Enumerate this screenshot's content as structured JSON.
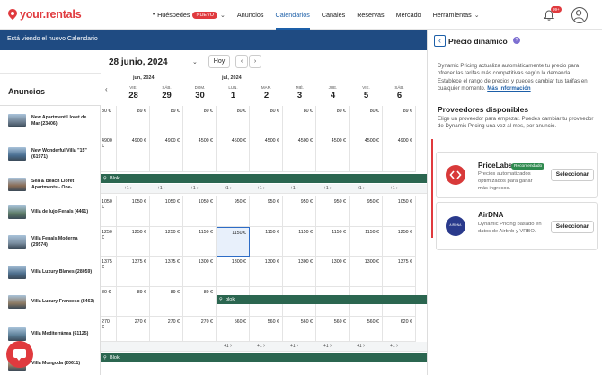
{
  "brand": {
    "name": "your.rentals",
    "accent": "#e03a3e"
  },
  "nav": {
    "items": [
      {
        "label": "Huéspedes",
        "badge": "NUEVO",
        "has_caret": true
      },
      {
        "label": "Anuncios"
      },
      {
        "label": "Calendarios",
        "active": true
      },
      {
        "label": "Canales"
      },
      {
        "label": "Reservas"
      },
      {
        "label": "Mercado"
      },
      {
        "label": "Herramientas",
        "has_caret": true
      }
    ],
    "notifications_count": "99+"
  },
  "banner": {
    "text": "Está viendo el nuevo Calendario"
  },
  "toolbar": {
    "date_title": "28 junio, 2024",
    "today_label": "Hoy",
    "prev": "‹",
    "next": "›"
  },
  "listings_header": "Anuncios",
  "calendar": {
    "months": [
      "jun, 2024",
      "jul, 2024"
    ],
    "days": [
      {
        "dow": "VIE.",
        "day": "28"
      },
      {
        "dow": "SÁB.",
        "day": "29"
      },
      {
        "dow": "DOM.",
        "day": "30"
      },
      {
        "dow": "LUN.",
        "day": "1"
      },
      {
        "dow": "MAR.",
        "day": "2"
      },
      {
        "dow": "MIÉ.",
        "day": "3"
      },
      {
        "dow": "JUE.",
        "day": "4"
      },
      {
        "dow": "VIE.",
        "day": "5"
      },
      {
        "dow": "SÁB.",
        "day": "6"
      }
    ],
    "rows": [
      {
        "name": "New Apartment Lloret de Mar (23406)",
        "lead": "80 €",
        "prices": [
          "89 €",
          "89 €",
          "80 €",
          "80 €",
          "80 €",
          "80 €",
          "80 €",
          "80 €",
          "89 €"
        ],
        "sub": null,
        "blk": null
      },
      {
        "name": "New Wonderful Villa \"15\" (61971)",
        "lead": "4900 €",
        "prices": [
          "4900 €",
          "4900 €",
          "4500 €",
          "4500 €",
          "4500 €",
          "4500 €",
          "4500 €",
          "4500 €",
          "4900 €"
        ],
        "sub": null,
        "blk": null
      },
      {
        "name": "Sea & Beach Lloret Apartments - One-...",
        "lead": "",
        "prices": [],
        "sub": [
          "+1",
          "+1",
          "+1",
          "+1",
          "+1",
          "+1",
          "+1",
          "+1",
          "+1"
        ],
        "blk": {
          "label": "Blok",
          "from": -1
        }
      },
      {
        "name": "Villa de lujo Fenals (4461)",
        "lead": "1050 €",
        "prices": [
          "1050 €",
          "1050 €",
          "1050 €",
          "950 €",
          "950 €",
          "950 €",
          "950 €",
          "950 €",
          "1050 €"
        ],
        "sub": null,
        "blk": null
      },
      {
        "name": "Villa Fenals Moderna (29574)",
        "lead": "1250 €",
        "prices": [
          "1250 €",
          "1250 €",
          "1150 €",
          "1150 €",
          "1150 €",
          "1150 €",
          "1150 €",
          "1150 €",
          "1250 €"
        ],
        "sub": null,
        "blk": null,
        "selected": 3
      },
      {
        "name": "Villa Luxury Blanes (28059)",
        "lead": "1375 €",
        "prices": [
          "1375 €",
          "1375 €",
          "1300 €",
          "1300 €",
          "1300 €",
          "1300 €",
          "1300 €",
          "1300 €",
          "1375 €"
        ],
        "sub": null,
        "blk": null
      },
      {
        "name": "Villa Luxury Francesc (8463)",
        "lead": "80 €",
        "prices": [
          "89 €",
          "89 €",
          "80 €",
          "",
          "",
          "",
          "",
          "",
          ""
        ],
        "sub": null,
        "blk": {
          "label": "blok",
          "from": 3
        }
      },
      {
        "name": "Villa Mediterránea (61125)",
        "lead": "270 €",
        "prices": [
          "270 €",
          "270 €",
          "270 €",
          "560 €",
          "560 €",
          "560 €",
          "560 €",
          "560 €",
          "620 €"
        ],
        "sub": [
          "",
          "",
          "",
          "+1",
          "+1",
          "+1",
          "+1",
          "+1",
          "+1"
        ],
        "blk": null
      },
      {
        "name": "Villa Mongoda (20611)",
        "lead": "",
        "prices": [],
        "sub": null,
        "blk": {
          "label": "Blok",
          "from": -1
        }
      }
    ]
  },
  "panel": {
    "title": "Precio dinamico",
    "description": "Dynamic Pricing actualiza automáticamente tu precio para ofrecer las tarifas más competitivas según la demanda. Establece el rango de precios y puedes cambiar tus tarifas en cualquier momento.",
    "more_link": "Más información",
    "providers_title": "Proveedores disponibles",
    "providers_desc": "Elige un proveedor para empezar. Puedes cambiar tu proveedor de Dynamic Pricing una vez al mes, por anuncio.",
    "providers": [
      {
        "name": "PriceLabs",
        "tag": "Recomendado",
        "desc": "Precios automatizados optimizados para ganar más ingresos.",
        "button": "Seleccionar",
        "logo_color": "#d83a3a",
        "logo_text": ""
      },
      {
        "name": "AirDNA",
        "tag": "",
        "desc": "Dynamic Pricing basado en datos de Airbnb y VRBO.",
        "button": "Seleccionar",
        "logo_color": "#2a3a8c",
        "logo_text": "AIRDNA"
      }
    ]
  }
}
